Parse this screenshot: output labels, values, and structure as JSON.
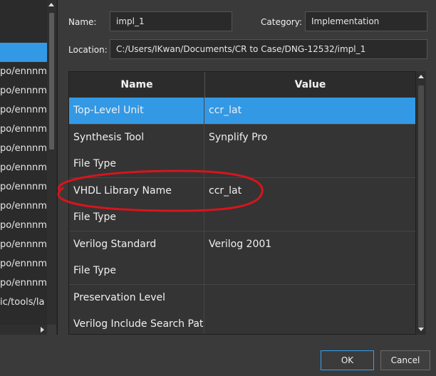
{
  "left_list": {
    "items": [
      {
        "text": "",
        "selected": false
      },
      {
        "text": "",
        "selected": false
      },
      {
        "text": "",
        "selected": true
      },
      {
        "text": "po/ennnm",
        "selected": false
      },
      {
        "text": "po/ennnm",
        "selected": false
      },
      {
        "text": "po/ennnm",
        "selected": false
      },
      {
        "text": "po/ennnm",
        "selected": false
      },
      {
        "text": "po/ennnm",
        "selected": false
      },
      {
        "text": "po/ennnm",
        "selected": false
      },
      {
        "text": "po/ennnm",
        "selected": false
      },
      {
        "text": "po/ennnm",
        "selected": false
      },
      {
        "text": "po/ennnm",
        "selected": false
      },
      {
        "text": "po/ennnm",
        "selected": false
      },
      {
        "text": "po/ennnm",
        "selected": false
      },
      {
        "text": "po/ennnm",
        "selected": false
      },
      {
        "text": "ic/tools/la",
        "selected": false
      },
      {
        "text": "",
        "selected": false
      }
    ]
  },
  "form": {
    "name_label": "Name:",
    "name_value": "impl_1",
    "category_label": "Category:",
    "category_value": "Implementation",
    "location_label": "Location:",
    "location_value": "C:/Users/IKwan/Documents/CR to Case/DNG-12532/impl_1"
  },
  "grid": {
    "headers": {
      "name": "Name",
      "value": "Value"
    },
    "rows": [
      {
        "name": "Top-Level Unit",
        "value": "ccr_lat",
        "selected": true
      },
      {
        "name": "Synthesis Tool",
        "value": "Synplify Pro",
        "selected": false
      },
      {
        "name": "File Type",
        "value": "",
        "selected": false
      },
      {
        "name": "VHDL Library Name",
        "value": "ccr_lat",
        "selected": false
      },
      {
        "name": "File Type",
        "value": "",
        "selected": false
      },
      {
        "name": "Verilog Standard",
        "value": "Verilog 2001",
        "selected": false
      },
      {
        "name": "File Type",
        "value": "",
        "selected": false
      },
      {
        "name": "Preservation Level",
        "value": "",
        "selected": false
      },
      {
        "name": "Verilog Include Search Path",
        "value": "",
        "selected": false
      }
    ]
  },
  "buttons": {
    "ok": "OK",
    "cancel": "Cancel"
  },
  "colors": {
    "selection": "#3399e5",
    "annotation": "#d8141c",
    "background": "#3a3a3a"
  },
  "icons": {
    "scroll_up": "arrow-up-icon",
    "scroll_down": "arrow-down-icon",
    "scroll_right": "arrow-right-icon"
  }
}
